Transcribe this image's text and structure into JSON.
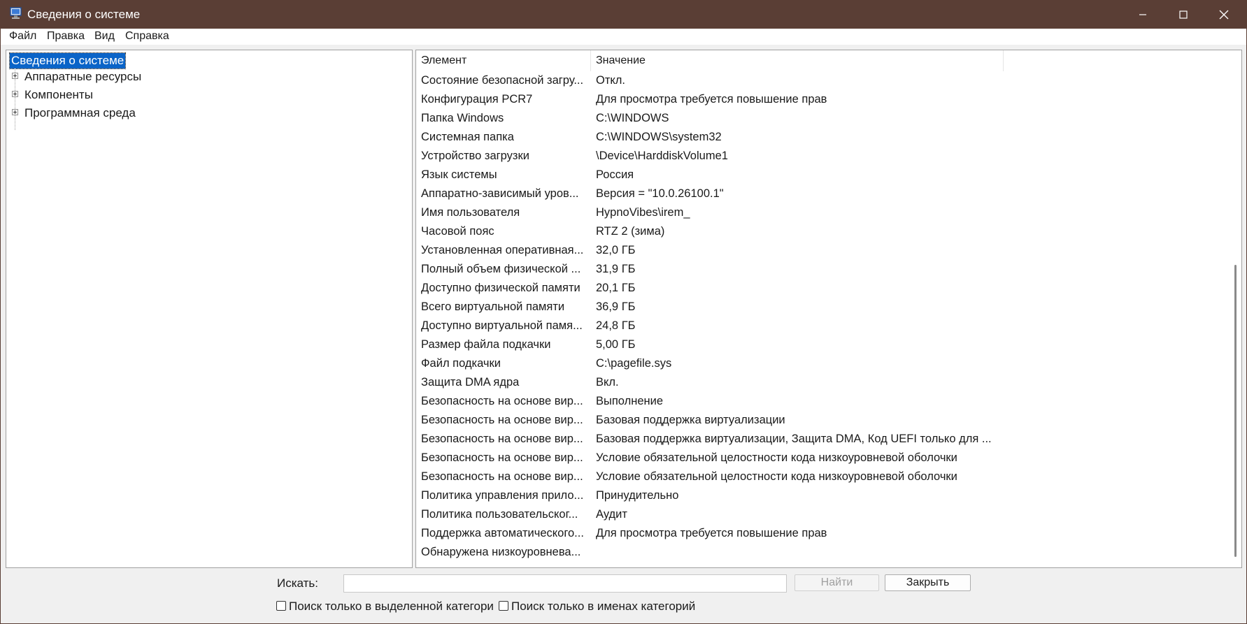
{
  "window": {
    "title": "Сведения о системе",
    "colors": {
      "titlebar": "#5a3e35",
      "selection": "#0a64c8"
    }
  },
  "menu": [
    "Файл",
    "Правка",
    "Вид",
    "Справка"
  ],
  "tree": {
    "root": "Сведения о системе",
    "children": [
      "Аппаратные ресурсы",
      "Компоненты",
      "Программная среда"
    ]
  },
  "table": {
    "headers": {
      "element": "Элемент",
      "value": "Значение"
    },
    "rows": [
      [
        "Состояние безопасной загру...",
        "Откл."
      ],
      [
        "Конфигурация PCR7",
        "Для просмотра требуется повышение прав"
      ],
      [
        "Папка Windows",
        "C:\\WINDOWS"
      ],
      [
        "Системная папка",
        "C:\\WINDOWS\\system32"
      ],
      [
        "Устройство загрузки",
        "\\Device\\HarddiskVolume1"
      ],
      [
        "Язык системы",
        "Россия"
      ],
      [
        "Аппаратно-зависимый уров...",
        "Версия = \"10.0.26100.1\""
      ],
      [
        "Имя пользователя",
        "HypnoVibes\\irem_"
      ],
      [
        "Часовой пояс",
        "RTZ 2 (зима)"
      ],
      [
        "Установленная оперативная...",
        "32,0 ГБ"
      ],
      [
        "Полный объем физической ...",
        "31,9 ГБ"
      ],
      [
        "Доступно физической памяти",
        "20,1 ГБ"
      ],
      [
        "Всего виртуальной памяти",
        "36,9 ГБ"
      ],
      [
        "Доступно виртуальной памя...",
        "24,8 ГБ"
      ],
      [
        "Размер файла подкачки",
        "5,00 ГБ"
      ],
      [
        "Файл подкачки",
        "C:\\pagefile.sys"
      ],
      [
        "Защита DMA ядра",
        "Вкл."
      ],
      [
        "Безопасность на основе вир...",
        "Выполнение"
      ],
      [
        "Безопасность на основе вир...",
        "Базовая поддержка виртуализации"
      ],
      [
        "Безопасность на основе вир...",
        "Базовая поддержка виртуализации, Защита DMA, Код UEFI только для ..."
      ],
      [
        "Безопасность на основе вир...",
        "Условие обязательной целостности кода низкоуровневой оболочки"
      ],
      [
        "Безопасность на основе вир...",
        "Условие обязательной целостности кода низкоуровневой оболочки"
      ],
      [
        "Политика управления прило...",
        "Принудительно"
      ],
      [
        "Политика пользовательског...",
        "Аудит"
      ],
      [
        "Поддержка автоматического...",
        "Для просмотра требуется повышение прав"
      ],
      [
        "Обнаружена низкоуровнева...",
        ""
      ]
    ]
  },
  "search": {
    "label": "Искать:",
    "value": "",
    "find_button": "Найти",
    "close_button": "Закрыть",
    "option_selected_category": "Поиск только в выделенной категори",
    "option_category_names": "Поиск только в именах категорий"
  }
}
